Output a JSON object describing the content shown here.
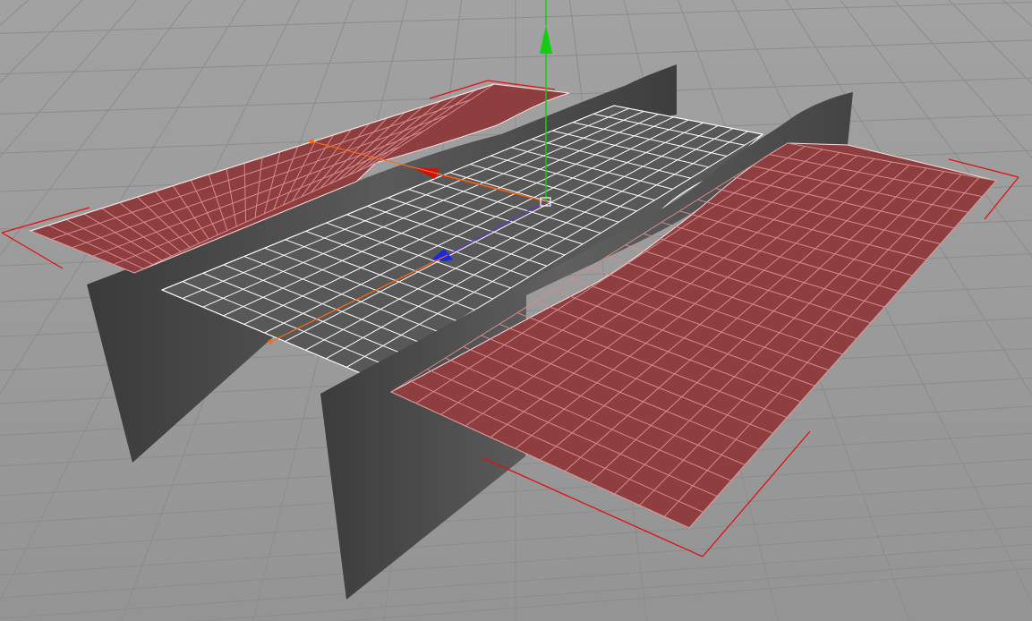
{
  "viewport": {
    "label": "",
    "colors": {
      "background": "#999999",
      "floor_grid": "#8c8c8c",
      "selected_plane": "#8e3e3e",
      "selected_grid": "#d28a8a",
      "selection_bracket": "#e01010",
      "center_plane": "#585858",
      "center_grid": "#ffffff",
      "wall": "#4a4a4a",
      "axis_x": "#cc1111",
      "axis_y": "#11cc11",
      "axis_z": "#1a2ad8",
      "handle": "#ff6a10"
    },
    "objects": [
      {
        "name": "left-selected-plane",
        "type": "plane",
        "selected": true
      },
      {
        "name": "right-selected-plane",
        "type": "plane",
        "selected": true
      },
      {
        "name": "center-plane",
        "type": "plane",
        "selected": false
      },
      {
        "name": "left-wall",
        "type": "extruded-spline",
        "selected": false
      },
      {
        "name": "right-wall",
        "type": "extruded-spline",
        "selected": false
      }
    ],
    "gizmo": {
      "axes": [
        "x",
        "y",
        "z"
      ],
      "icons": [
        "move-y-arrow-icon",
        "move-x-arrow-icon",
        "move-z-arrow-icon"
      ]
    }
  }
}
